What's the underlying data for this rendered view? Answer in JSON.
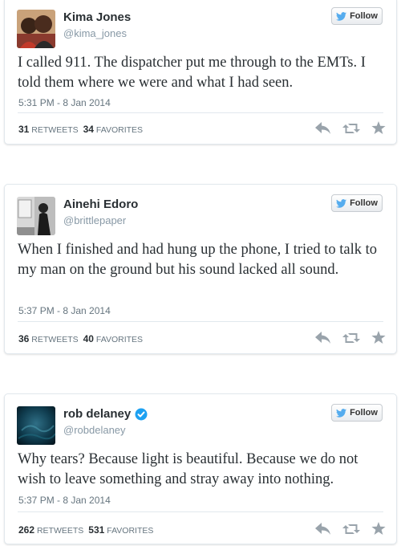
{
  "tweets": [
    {
      "name": "Kima Jones",
      "handle": "@kima_jones",
      "verified": false,
      "follow_label": "Follow",
      "text": "I called 911. The dispatcher put me through to the EMTs. I told them where we were and what I had seen.",
      "timestamp": "5:31 PM - 8 Jan 2014",
      "retweets": "31",
      "retweets_label": "RETWEETS",
      "favorites": "34",
      "favorites_label": "FAVORITES"
    },
    {
      "name": "Ainehi Edoro",
      "handle": "@brittlepaper",
      "verified": false,
      "follow_label": "Follow",
      "text": "When I finished and had hung up the phone, I tried to talk to my man on the ground but his sound lacked all sound.",
      "timestamp": "5:37 PM - 8 Jan 2014",
      "retweets": "36",
      "retweets_label": "RETWEETS",
      "favorites": "40",
      "favorites_label": "FAVORITES"
    },
    {
      "name": "rob delaney",
      "handle": "@robdelaney",
      "verified": true,
      "follow_label": "Follow",
      "text": "Why tears? Because light is beautiful. Because we do not wish to leave something and stray away into nothing.",
      "timestamp": "5:37 PM - 8 Jan 2014",
      "retweets": "262",
      "retweets_label": "RETWEETS",
      "favorites": "531",
      "favorites_label": "FAVORITES"
    }
  ],
  "colors": {
    "twitter_blue": "#55acee",
    "verified_blue": "#1da1f2",
    "action_gray": "#99a3ab",
    "text": "#292f33",
    "muted": "#66757f"
  },
  "icons": [
    "bird-icon",
    "verified-icon",
    "reply-icon",
    "retweet-icon",
    "favorite-icon"
  ]
}
